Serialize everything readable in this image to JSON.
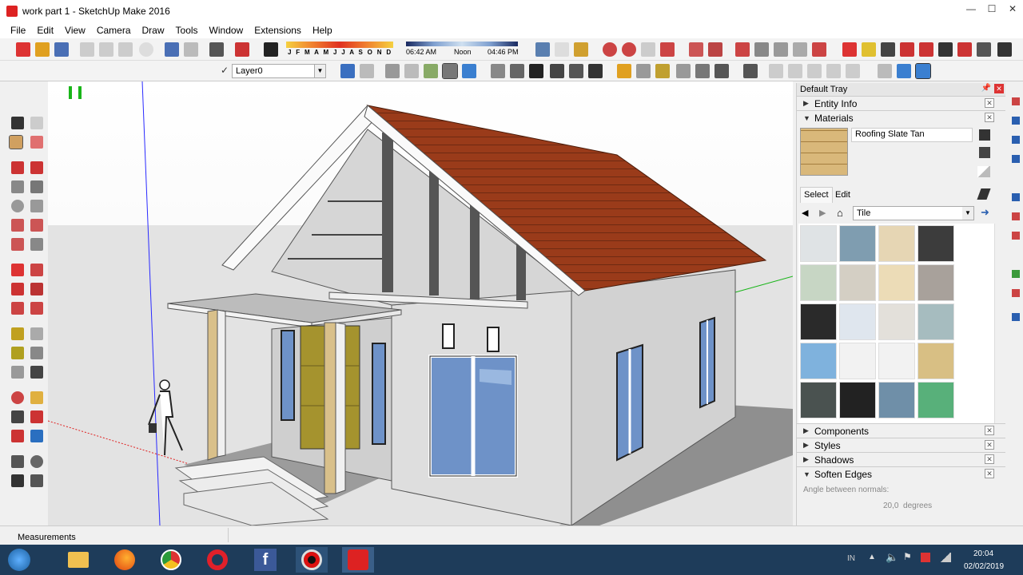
{
  "window": {
    "title": "work part 1 - SketchUp Make 2016",
    "min": "—",
    "max": "☐",
    "close": "✕"
  },
  "menu": [
    "File",
    "Edit",
    "View",
    "Camera",
    "Draw",
    "Tools",
    "Window",
    "Extensions",
    "Help"
  ],
  "shadow_toolbar": {
    "months": "J F M A M J J A S O N D",
    "time_start": "06:42 AM",
    "time_mid": "Noon",
    "time_end": "04:46 PM"
  },
  "layer_select": {
    "value": "Layer0"
  },
  "tray": {
    "title": "Default Tray",
    "entity_info": "Entity Info",
    "materials": "Materials",
    "material_name": "Roofing Slate Tan",
    "tab_select": "Select",
    "tab_edit": "Edit",
    "library": "Tile",
    "components": "Components",
    "styles": "Styles",
    "shadows": "Shadows",
    "soften_edges": "Soften Edges",
    "angle_label": "Angle between normals:",
    "angle_value": "20,0  degrees"
  },
  "swatch_colors": [
    "#dfe3e5",
    "#7f9db0",
    "#e6d6b4",
    "#3c3c3c",
    "#c7d6c4",
    "#d4cfc4",
    "#ecdcb7",
    "#a8a19b",
    "#2a2a2a",
    "#dfe6ee",
    "#e3e0da",
    "#a6bcbf",
    "#7fb2dd",
    "#f2f2f2",
    "#f2f2f2",
    "#d8bf84",
    "#4a5250",
    "#222222",
    "#6f8fa8",
    "#58b07a"
  ],
  "status": {
    "measurements": "Measurements"
  },
  "taskbar": {
    "time": "20:04",
    "date": "02/02/2019",
    "lang": "IN"
  },
  "colors": {
    "roof": "#9a3b1a",
    "wall": "#d9d9d9",
    "glass": "#6e92c8",
    "door": "#a5932e",
    "axis_blue": "#2a2aff",
    "axis_red": "#e02020",
    "axis_green": "#19b519"
  }
}
